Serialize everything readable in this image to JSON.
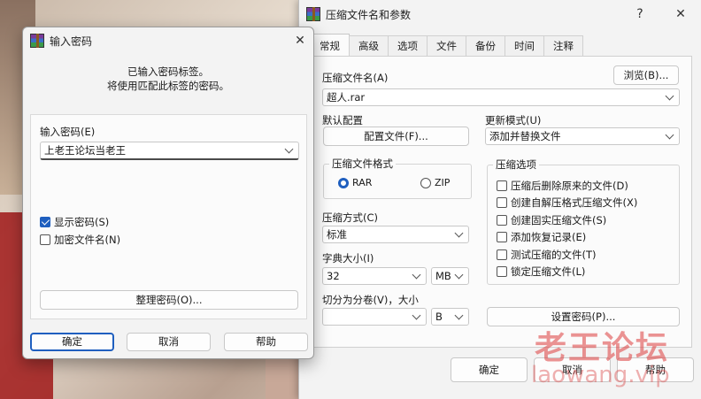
{
  "archive_window": {
    "title": "压缩文件名和参数",
    "help_glyph": "?",
    "close_glyph": "✕",
    "tabs": [
      "常规",
      "高级",
      "选项",
      "文件",
      "备份",
      "时间",
      "注释"
    ],
    "archive_name_label": "压缩文件名(A)",
    "browse_button": "浏览(B)...",
    "archive_name_value": "超人.rar",
    "default_profile_label": "默认配置",
    "profiles_button": "配置文件(F)...",
    "update_mode_label": "更新模式(U)",
    "update_mode_value": "添加并替换文件",
    "format_group": "压缩文件格式",
    "format_options": [
      "RAR",
      "ZIP"
    ],
    "format_selected": "RAR",
    "method_label": "压缩方式(C)",
    "method_value": "标准",
    "dict_label": "字典大小(I)",
    "dict_value": "32",
    "dict_unit": "MB",
    "split_label": "切分为分卷(V)，大小",
    "split_value": "",
    "split_unit": "B",
    "options_group": "压缩选项",
    "options": [
      {
        "label": "压缩后删除原来的文件(D)",
        "checked": false
      },
      {
        "label": "创建自解压格式压缩文件(X)",
        "checked": false
      },
      {
        "label": "创建固实压缩文件(S)",
        "checked": false
      },
      {
        "label": "添加恢复记录(E)",
        "checked": false
      },
      {
        "label": "测试压缩的文件(T)",
        "checked": false
      },
      {
        "label": "锁定压缩文件(L)",
        "checked": false
      }
    ],
    "set_password_button": "设置密码(P)...",
    "ok_button": "确定",
    "cancel_button": "取消",
    "help_button": "帮助"
  },
  "password_dialog": {
    "title": "输入密码",
    "close_glyph": "✕",
    "info_line1": "已输入密码标签。",
    "info_line2": "将使用匹配此标签的密码。",
    "password_label": "输入密码(E)",
    "password_value": "上老王论坛当老王",
    "show_password_label": "显示密码(S)",
    "show_password_checked": true,
    "encrypt_names_label": "加密文件名(N)",
    "encrypt_names_checked": false,
    "organize_button": "整理密码(O)...",
    "ok_button": "确定",
    "cancel_button": "取消",
    "help_button": "帮助"
  },
  "watermark": {
    "line1": "老王论坛",
    "line2": "laowang.vip"
  },
  "colors": {
    "accent": "#1f5fbf",
    "window_bg": "#f3f3f3",
    "watermark": "#dc3c3c"
  }
}
